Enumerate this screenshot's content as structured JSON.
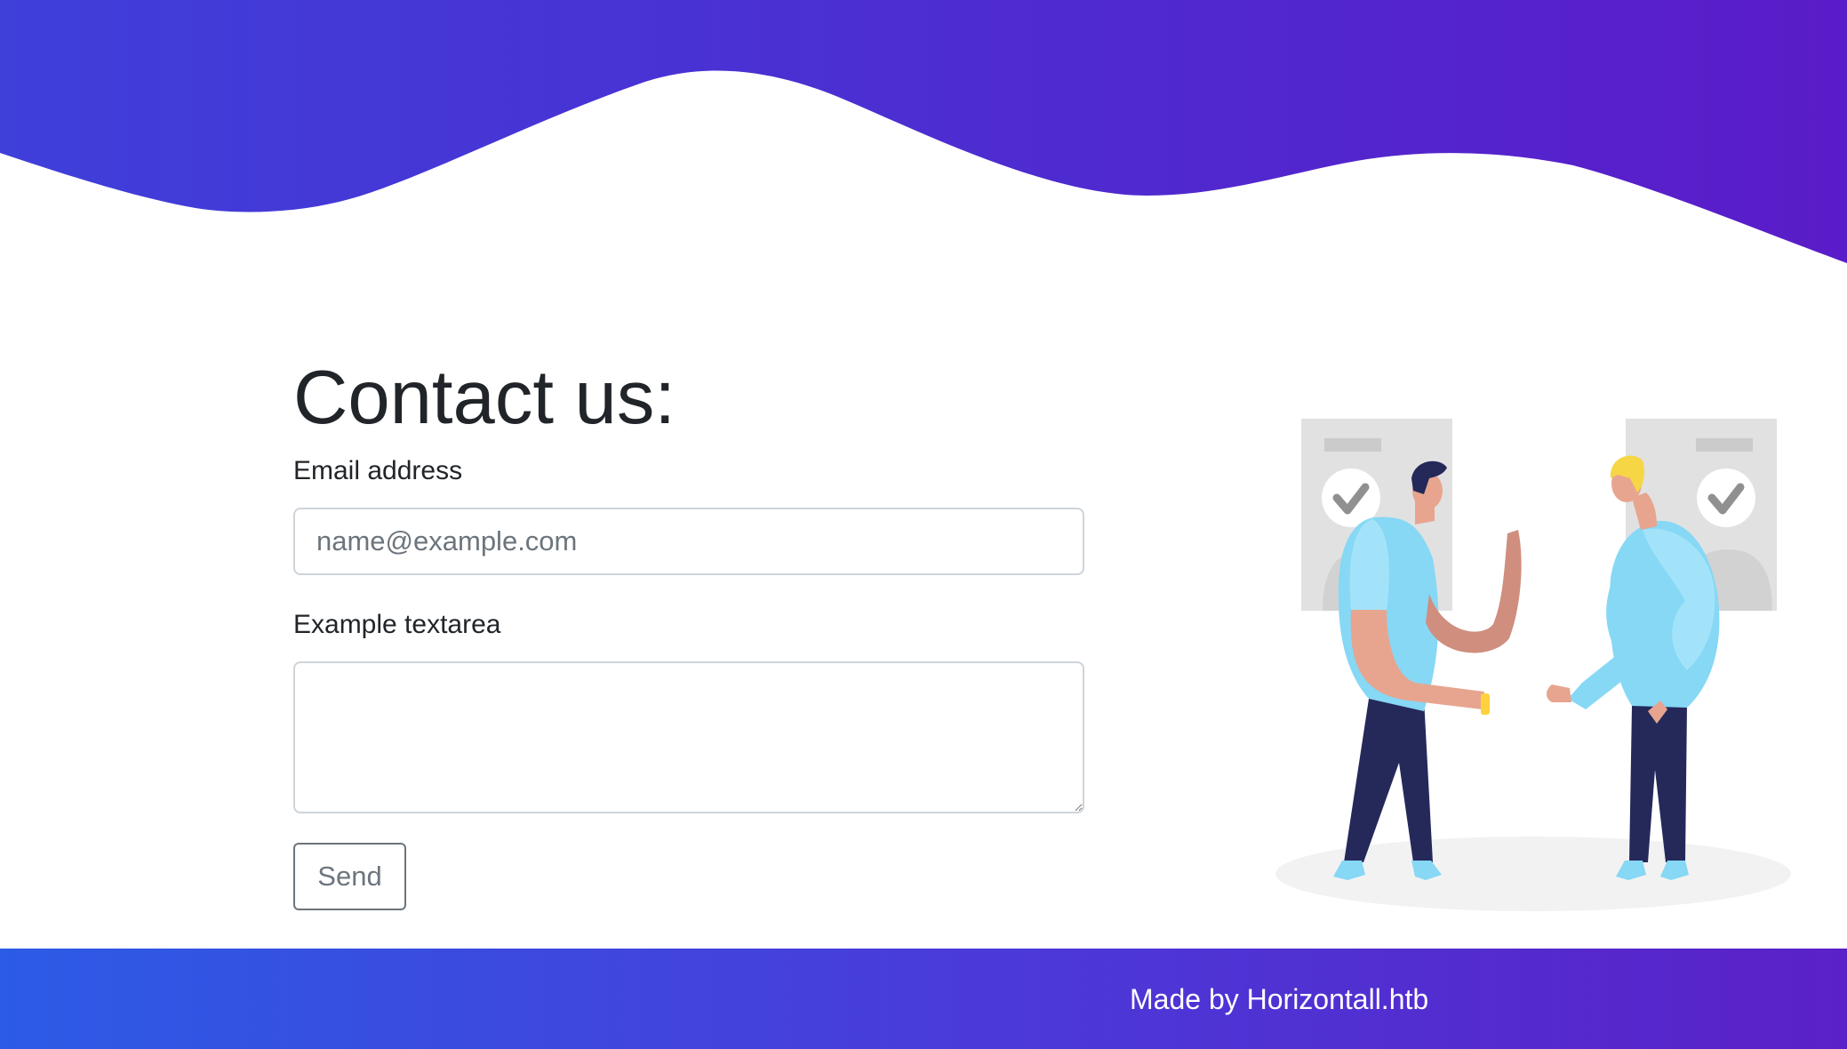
{
  "contact": {
    "title": "Contact us:",
    "email_label": "Email address",
    "email_placeholder": "name@example.com",
    "email_value": "",
    "textarea_label": "Example textarea",
    "textarea_value": "",
    "send_label": "Send"
  },
  "footer": {
    "text": "Made by Horizontall.htb"
  },
  "theme": {
    "hero_gradient": [
      "#3f3fda",
      "#5a1cc8"
    ],
    "footer_gradient": [
      "#2c5be6",
      "#5a21c8"
    ],
    "shirt_color": "#86d8f5",
    "pants_color": "#25295a",
    "skin_color": "#e7a58f"
  }
}
